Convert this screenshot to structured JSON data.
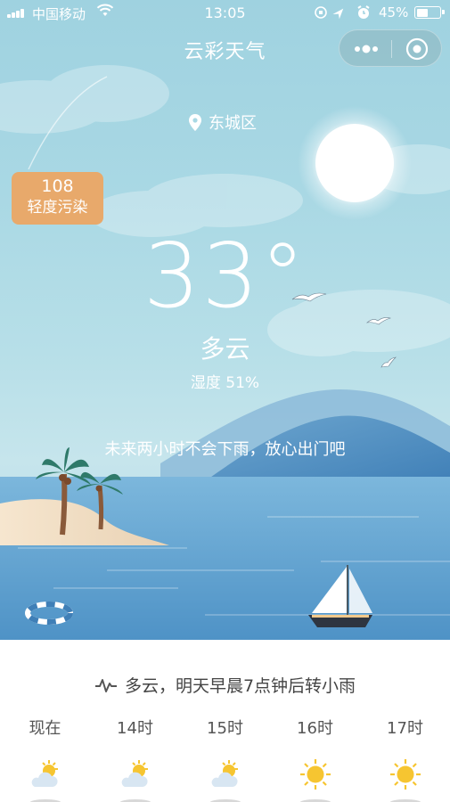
{
  "status_bar": {
    "carrier": "中国移动",
    "time": "13:05",
    "battery_text": "45%",
    "battery_level": 0.45
  },
  "nav": {
    "title": "云彩天气"
  },
  "location": {
    "name": "东城区"
  },
  "air_quality": {
    "value": "108",
    "label": "轻度污染"
  },
  "weather": {
    "temperature": "33°",
    "condition": "多云",
    "humidity": "湿度 51%",
    "rain_tip": "未来两小时不会下雨，放心出门吧"
  },
  "forecast": {
    "summary": "多云，明天早晨7点钟后转小雨",
    "hours": [
      {
        "label": "现在",
        "icon": "partly-cloudy-icon"
      },
      {
        "label": "14时",
        "icon": "partly-cloudy-icon"
      },
      {
        "label": "15时",
        "icon": "partly-cloudy-icon"
      },
      {
        "label": "16时",
        "icon": "sun-icon"
      },
      {
        "label": "17时",
        "icon": "sun-icon"
      }
    ]
  },
  "colors": {
    "aqi_badge": "#e8a96b",
    "sky": "#a9d8e4",
    "sea": "#5a9ccc",
    "sun_icon": "#f6c531"
  }
}
